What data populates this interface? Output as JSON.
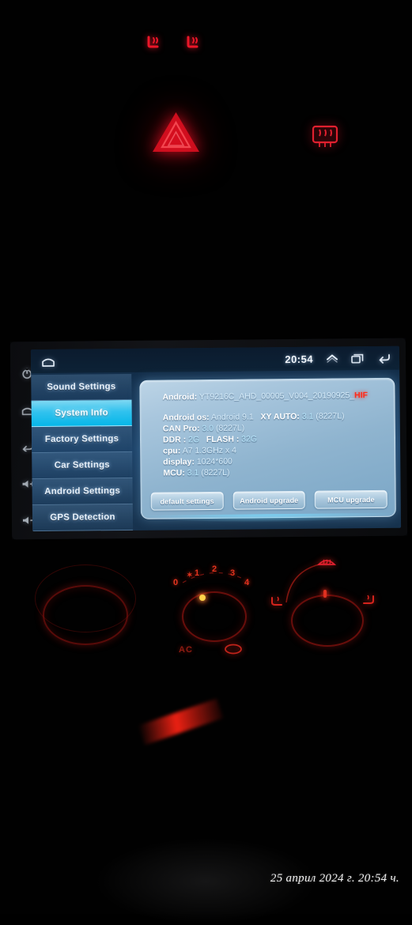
{
  "dashboard": {
    "indicators": [
      {
        "name": "heated-seat-left",
        "label": "Heated seat left",
        "color": "#e8152a"
      },
      {
        "name": "heated-seat-right",
        "label": "Heated seat right",
        "color": "#e8152a"
      },
      {
        "name": "hazard-warning",
        "label": "Hazard warning lights",
        "color": "#e20f23"
      },
      {
        "name": "rear-defroster",
        "label": "Rear window defroster",
        "color": "#e0202f"
      }
    ]
  },
  "head_unit": {
    "side_keys": [
      {
        "name": "power",
        "glyph": "power"
      },
      {
        "name": "home",
        "glyph": "home"
      },
      {
        "name": "back",
        "glyph": "back"
      },
      {
        "name": "volume-up",
        "label": "+"
      },
      {
        "name": "volume-down",
        "label": "−"
      }
    ],
    "status_bar": {
      "home_icon": "home-icon",
      "clock": "20:54",
      "chevron_icon": "chevron-up-icon",
      "recents_icon": "recents-icon",
      "back_icon": "back-arrow-icon"
    },
    "menu": {
      "items": [
        {
          "label": "Sound Settings",
          "active": false
        },
        {
          "label": "System Info",
          "active": true
        },
        {
          "label": "Factory Settings",
          "active": false
        },
        {
          "label": "Car Settings",
          "active": false
        },
        {
          "label": "Android Settings",
          "active": false
        },
        {
          "label": "GPS Detection",
          "active": false
        }
      ],
      "active_color": "#06b6e8"
    },
    "system_info": {
      "android_label": "Android:",
      "android_value": "YT9216C_AHD_00005_V004_20190925_",
      "android_overflow": "HIF",
      "android_overflow_tail": "I",
      "lines": [
        {
          "label": "Android os:",
          "value": "Android 9.1",
          "label2": "XY AUTO:",
          "value2": "3.1",
          "value2_extra": "(8227L)"
        },
        {
          "label": "CAN Pro:",
          "value": "3.0",
          "value_extra": "(8227L)"
        },
        {
          "label": "DDR :",
          "value": "2G",
          "label2": "FLASH :",
          "value2": "32G"
        },
        {
          "label": "cpu:",
          "value": "A7 1.3GHz x 4"
        },
        {
          "label": "display:",
          "value": "1024*600"
        },
        {
          "label": "MCU:",
          "value": "3.1",
          "value_extra": "(8227L)"
        }
      ],
      "buttons": [
        {
          "label": "default settings"
        },
        {
          "label": "Android upgrade"
        },
        {
          "label": "MCU upgrade"
        }
      ]
    }
  },
  "climate": {
    "fan_scale": [
      "0",
      "1",
      "2",
      "3",
      "4"
    ],
    "fan_snowflake": "✶",
    "ac_label": "AC",
    "knobs": [
      {
        "name": "temperature-knob"
      },
      {
        "name": "fan-speed-knob"
      },
      {
        "name": "air-distribution-knob"
      }
    ],
    "mode_icons": [
      "windshield-defrost-icon",
      "face-vent-icon",
      "floor-vent-icon",
      "recirculation-icon"
    ]
  },
  "photo": {
    "timestamp": "25 април 2024 г. 20:54 ч."
  }
}
